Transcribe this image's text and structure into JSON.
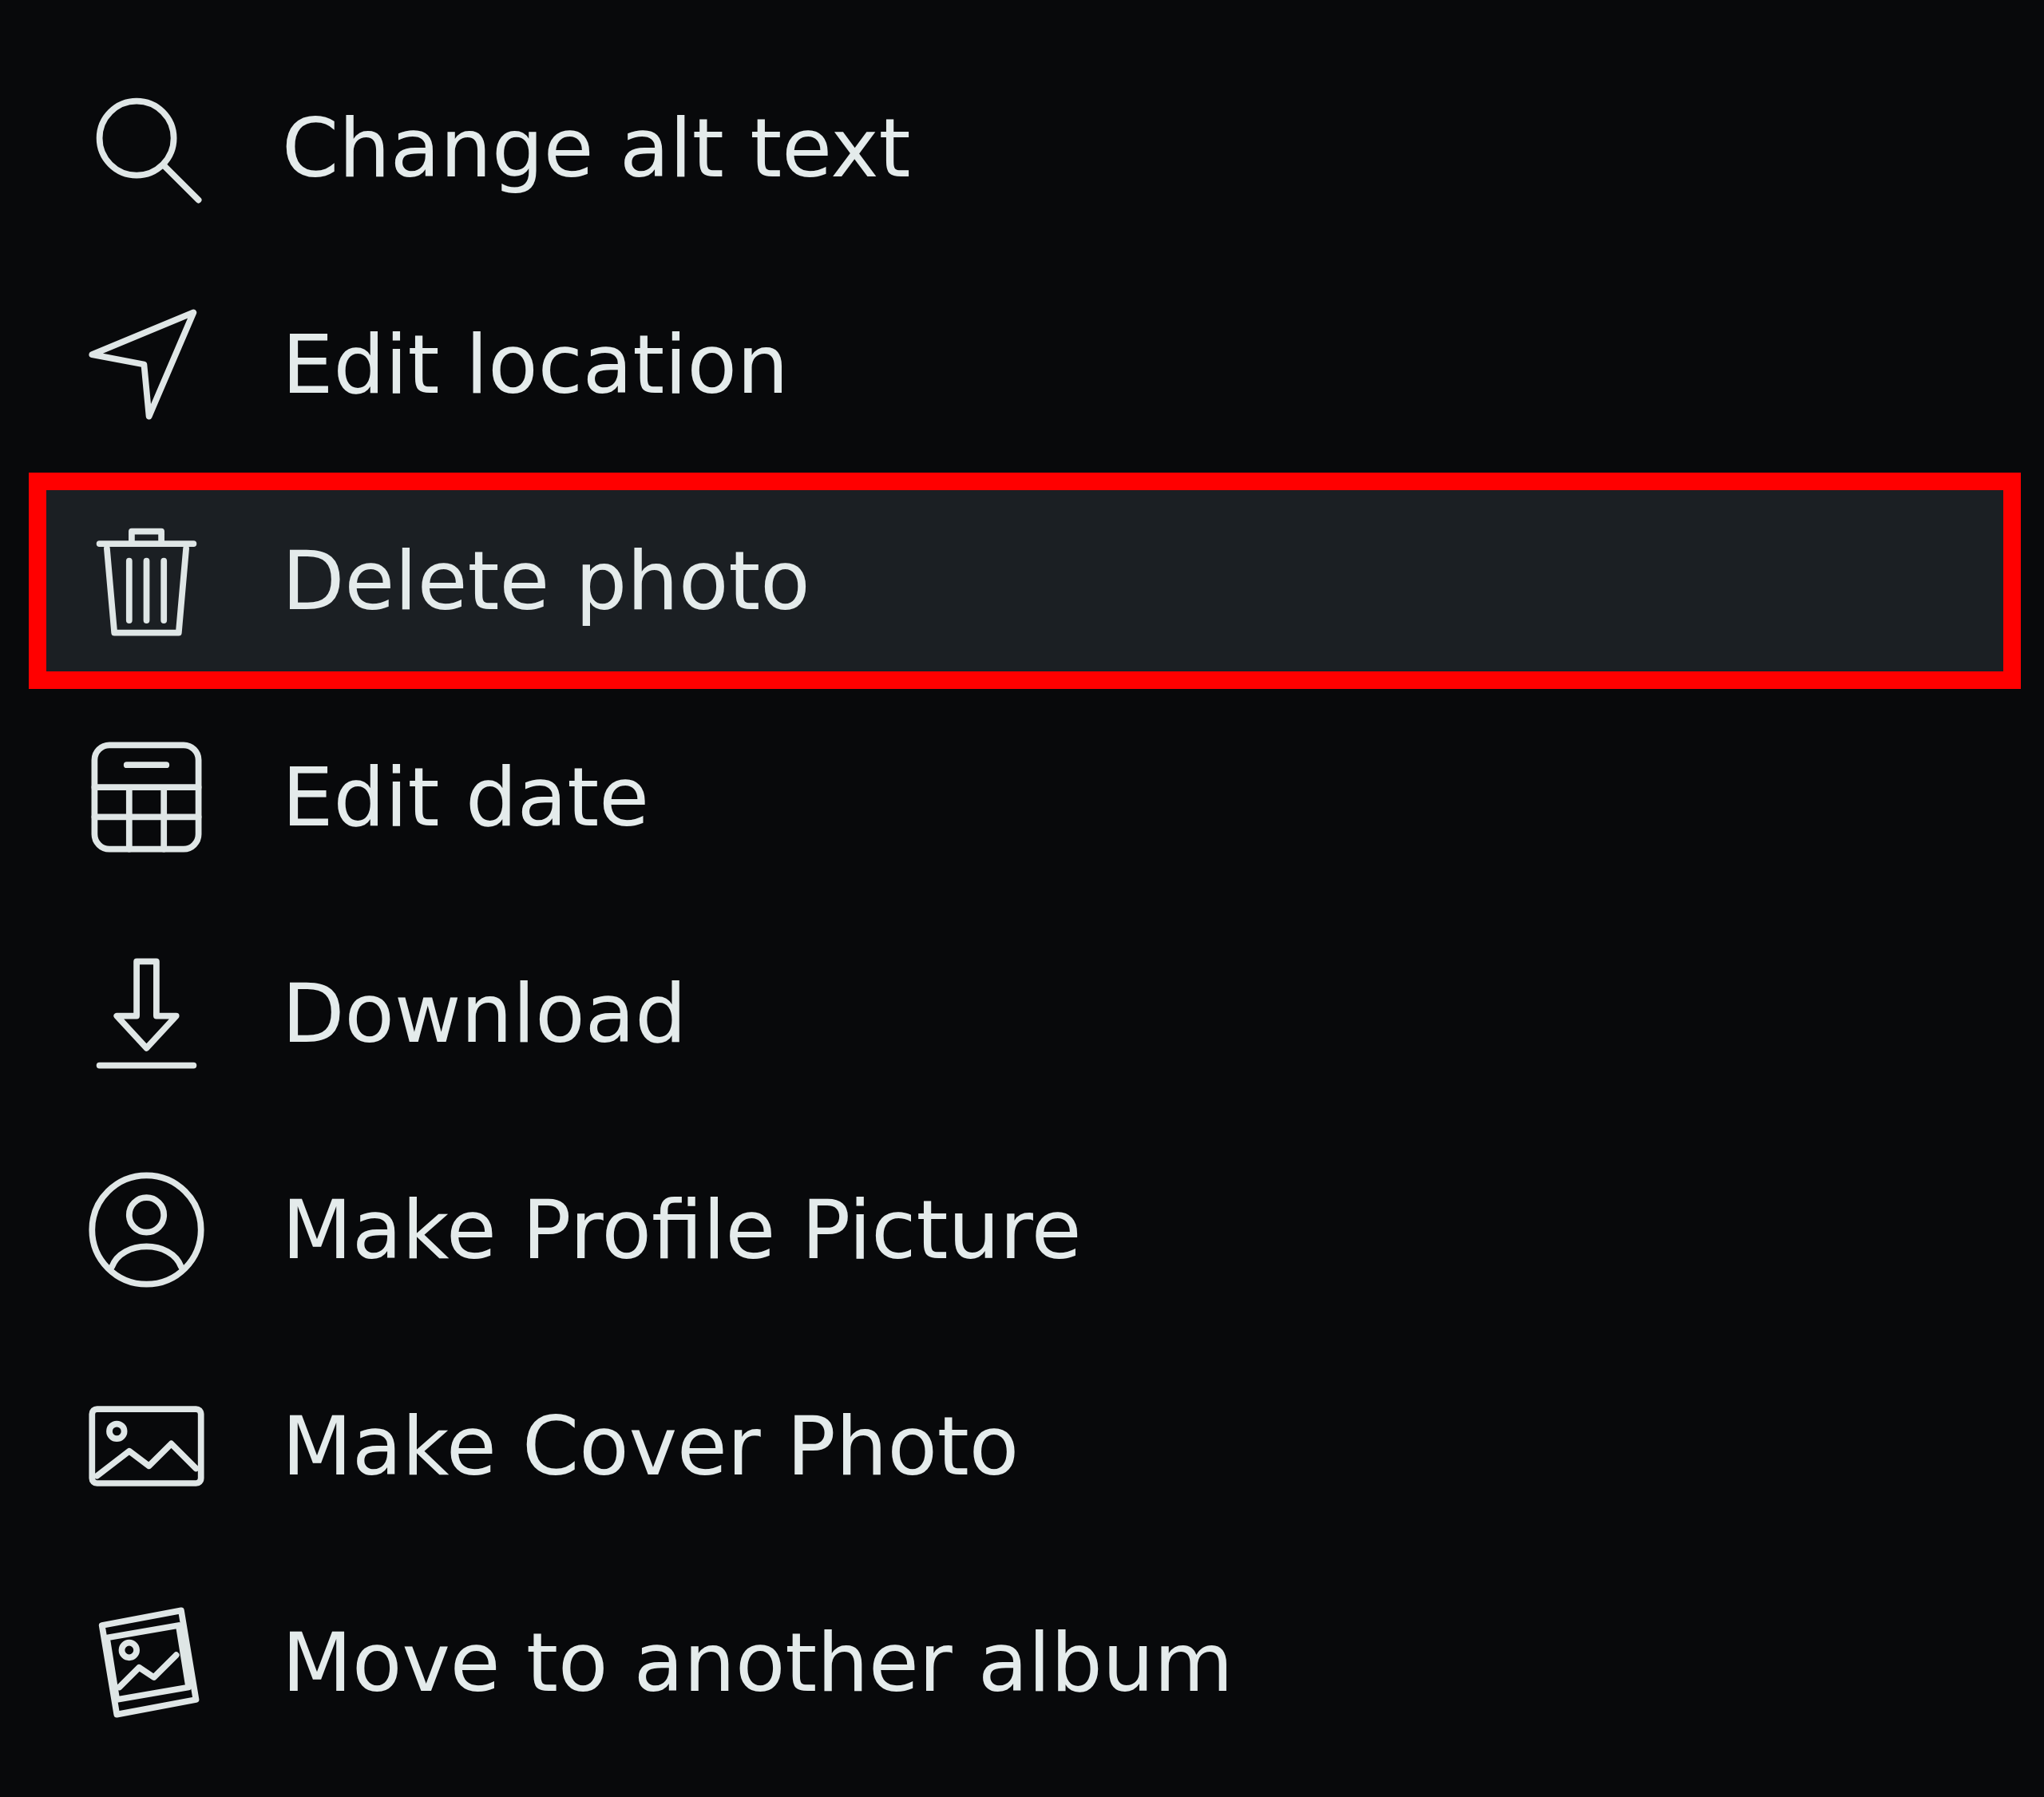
{
  "menu": {
    "items": [
      {
        "label": "Change alt text",
        "selected": false
      },
      {
        "label": "Edit location",
        "selected": false
      },
      {
        "label": "Delete photo",
        "selected": true
      },
      {
        "label": "Edit date",
        "selected": false
      },
      {
        "label": "Download",
        "selected": false
      },
      {
        "label": "Make Profile Picture",
        "selected": false
      },
      {
        "label": "Make Cover Photo",
        "selected": false
      },
      {
        "label": "Move to another album",
        "selected": false
      }
    ]
  }
}
